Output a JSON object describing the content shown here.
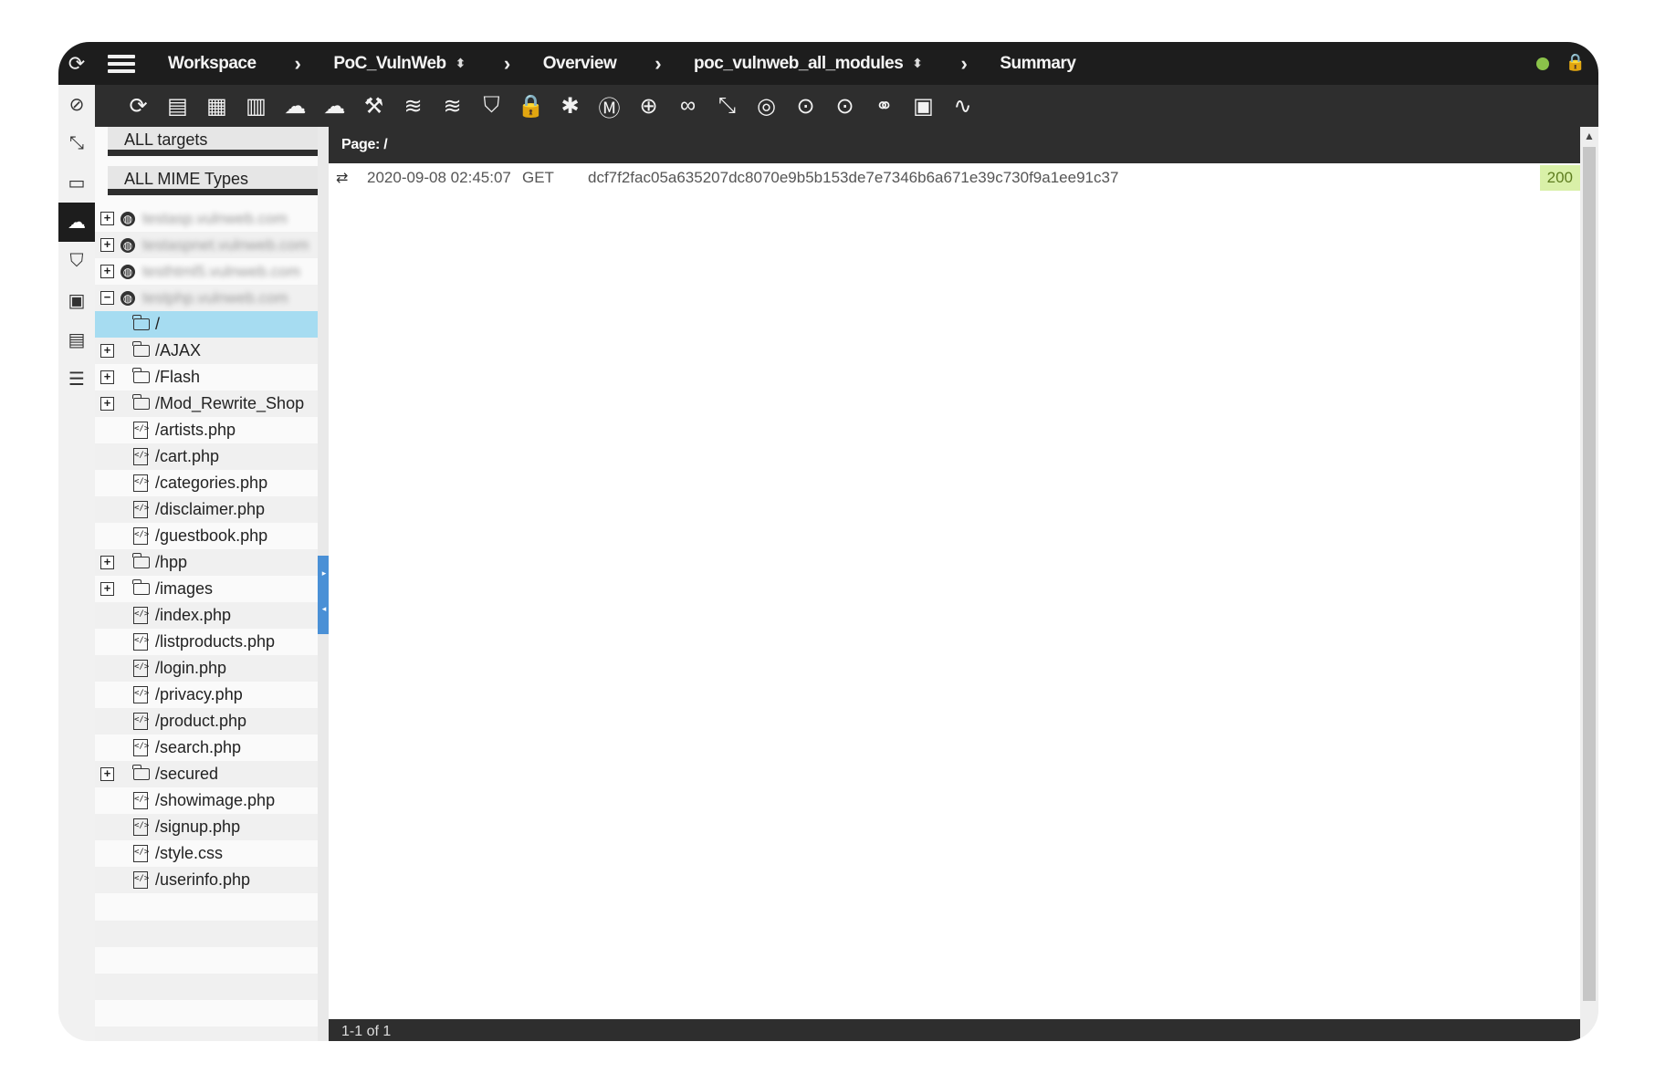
{
  "breadcrumb": {
    "workspace": "Workspace",
    "project": "PoC_VulnWeb",
    "overview": "Overview",
    "scan": "poc_vulnweb_all_modules",
    "summary": "Summary"
  },
  "icons": {
    "logo": "app-logo-icon",
    "menu": "hamburger-menu-icon",
    "status": "online-status-dot",
    "user": "user-lock-icon"
  },
  "colors": {
    "topbar": "#1d1d1d",
    "toolbar": "#2e2e2e",
    "selected_row": "#a6dcf1",
    "status_ok_bg": "#d9f0a8",
    "status_dot": "#8bc34a",
    "splitter_handle": "#4a90d6"
  },
  "rail": [
    "compass-icon",
    "path-icon",
    "monitor-icon",
    "cloud-icon",
    "shield-icon",
    "inbox-icon",
    "database-icon",
    "checklist-icon"
  ],
  "toolbar": [
    "refresh-icon",
    "database-icon",
    "database-stack-icon",
    "database-edit-icon",
    "cloud-upload-icon",
    "cloud-icon",
    "hammer-icon",
    "layers-icon",
    "layers-alt-icon",
    "shield-icon",
    "lock-icon",
    "bug-icon",
    "malware-icon",
    "globe-icon",
    "binoculars-icon",
    "path-icon",
    "dns-icon",
    "whois-icon",
    "rdap-icon",
    "link-circles-icon",
    "inbox-icon",
    "pulse-icon"
  ],
  "filters": {
    "targets": "ALL targets",
    "mime": "ALL MIME Types"
  },
  "tree": {
    "hosts": [
      "testasp.vulnweb.com",
      "testaspnet.vulnweb.com",
      "testhtml5.vulnweb.com",
      "testphp.vulnweb.com"
    ],
    "items": [
      {
        "label": "/",
        "kind": "folder",
        "expandable": false
      },
      {
        "label": "/AJAX",
        "kind": "folder",
        "expandable": true
      },
      {
        "label": "/Flash",
        "kind": "folder",
        "expandable": true
      },
      {
        "label": "/Mod_Rewrite_Shop",
        "kind": "folder",
        "expandable": true
      },
      {
        "label": "/artists.php",
        "kind": "file",
        "expandable": false
      },
      {
        "label": "/cart.php",
        "kind": "file",
        "expandable": false
      },
      {
        "label": "/categories.php",
        "kind": "file",
        "expandable": false
      },
      {
        "label": "/disclaimer.php",
        "kind": "file",
        "expandable": false
      },
      {
        "label": "/guestbook.php",
        "kind": "file",
        "expandable": false
      },
      {
        "label": "/hpp",
        "kind": "folder",
        "expandable": true
      },
      {
        "label": "/images",
        "kind": "folder",
        "expandable": true
      },
      {
        "label": "/index.php",
        "kind": "file",
        "expandable": false
      },
      {
        "label": "/listproducts.php",
        "kind": "file",
        "expandable": false
      },
      {
        "label": "/login.php",
        "kind": "file",
        "expandable": false
      },
      {
        "label": "/privacy.php",
        "kind": "file",
        "expandable": false
      },
      {
        "label": "/product.php",
        "kind": "file",
        "expandable": false
      },
      {
        "label": "/search.php",
        "kind": "file",
        "expandable": false
      },
      {
        "label": "/secured",
        "kind": "folder",
        "expandable": true
      },
      {
        "label": "/showimage.php",
        "kind": "file",
        "expandable": false
      },
      {
        "label": "/signup.php",
        "kind": "file",
        "expandable": false
      },
      {
        "label": "/style.css",
        "kind": "file",
        "expandable": false
      },
      {
        "label": "/userinfo.php",
        "kind": "file",
        "expandable": false
      }
    ]
  },
  "main": {
    "page_header": "Page: /",
    "request": {
      "timestamp": "2020-09-08 02:45:07",
      "method": "GET",
      "hash": "dcf7f2fac05a635207dc8070e9b5b153de7e7346b6a671e39c730f9a1ee91c37",
      "status": "200"
    },
    "pager": "1-1 of 1"
  }
}
